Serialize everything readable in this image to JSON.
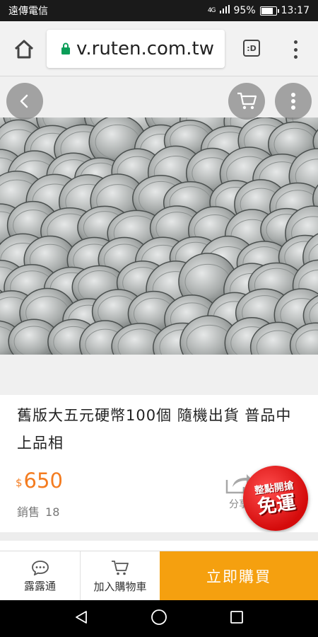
{
  "status_bar": {
    "carrier": "遠傳電信",
    "network": "4G",
    "battery_percent": "95%",
    "battery_level": 0.95,
    "time": "13:17"
  },
  "browser": {
    "url": "v.ruten.com.tw",
    "tabs_label": ":D",
    "accent_color": "#0a9d58"
  },
  "product": {
    "title": "舊版大五元硬幣100個  隨機出貨  普品中上品相",
    "currency": "$",
    "price": "650",
    "sales_label": "銷售",
    "sales_count": "18",
    "share_label": "分享",
    "badge_line1": "整點開搶",
    "badge_line2": "免運",
    "price_color": "#f47c20"
  },
  "actions": {
    "chat_label": "露露通",
    "cart_label": "加入購物車",
    "buy_label": "立即購買",
    "buy_color": "#f5a00f"
  },
  "icons": {
    "home": "home-icon",
    "lock": "lock-icon",
    "menu": "more-vert-icon",
    "back": "back-arrow-icon",
    "cart": "cart-icon",
    "share": "share-icon",
    "chat": "chat-bubble-icon"
  }
}
